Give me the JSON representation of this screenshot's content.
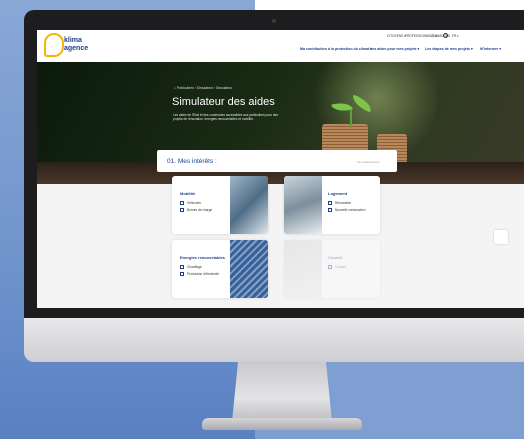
{
  "site": {
    "logo": {
      "line1": "klima",
      "line2": "agence"
    },
    "top_links": [
      "CITOYENS ▾",
      "PROFESSIONNELS ▾",
      "COMMUNES",
      "FR ▾"
    ],
    "nav": [
      "Ma contribution à la protection du climat ▾",
      "Les aides pour mes projets ▾",
      "Les étapes de mes projets ▾",
      "M'informer ▾"
    ]
  },
  "hero": {
    "breadcrumb": "⌂  Particuliers  ›  Simulateur  ›  Simulateur",
    "title": "Simulateur des aides",
    "description": "Les aides de l'Etat et des communes accessibles aux particuliers pour des projets de rénovation, énergies renouvelables et mobilité."
  },
  "section": {
    "title": "01.  Mes intérêts :",
    "link": "Tout sélectionner"
  },
  "cards": [
    {
      "title": "Mobilité",
      "options": [
        "Véhicules",
        "Bornes de charge"
      ]
    },
    {
      "title": "Logement",
      "options": [
        "Rénovation",
        "Nouvelle construction"
      ]
    },
    {
      "title": "Energies renouvelables",
      "options": [
        "Chauffage",
        "Production d'électricité"
      ]
    },
    {
      "title": "Conseil",
      "options": [
        "Conseil"
      ]
    }
  ],
  "colors": {
    "brand": "#1d3f8a",
    "accent": "#f2b705",
    "leaf": "#7cc44a"
  }
}
